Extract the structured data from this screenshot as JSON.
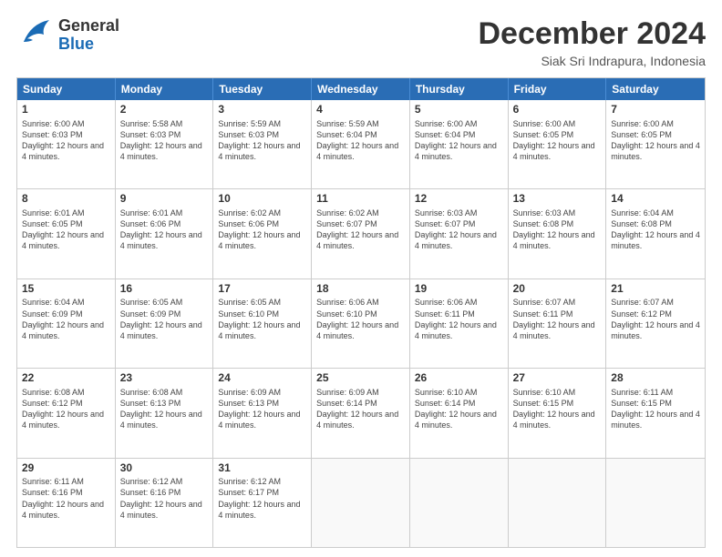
{
  "header": {
    "logo_general": "General",
    "logo_blue": "Blue",
    "month_title": "December 2024",
    "location": "Siak Sri Indrapura, Indonesia"
  },
  "days_of_week": [
    "Sunday",
    "Monday",
    "Tuesday",
    "Wednesday",
    "Thursday",
    "Friday",
    "Saturday"
  ],
  "weeks": [
    [
      {
        "day": 1,
        "sunrise": "6:00 AM",
        "sunset": "6:03 PM",
        "daylight": "12 hours and 4 minutes."
      },
      {
        "day": 2,
        "sunrise": "5:58 AM",
        "sunset": "6:03 PM",
        "daylight": "12 hours and 4 minutes."
      },
      {
        "day": 3,
        "sunrise": "5:59 AM",
        "sunset": "6:03 PM",
        "daylight": "12 hours and 4 minutes."
      },
      {
        "day": 4,
        "sunrise": "5:59 AM",
        "sunset": "6:04 PM",
        "daylight": "12 hours and 4 minutes."
      },
      {
        "day": 5,
        "sunrise": "6:00 AM",
        "sunset": "6:04 PM",
        "daylight": "12 hours and 4 minutes."
      },
      {
        "day": 6,
        "sunrise": "6:00 AM",
        "sunset": "6:05 PM",
        "daylight": "12 hours and 4 minutes."
      },
      {
        "day": 7,
        "sunrise": "6:00 AM",
        "sunset": "6:05 PM",
        "daylight": "12 hours and 4 minutes."
      }
    ],
    [
      {
        "day": 8,
        "sunrise": "6:01 AM",
        "sunset": "6:05 PM",
        "daylight": "12 hours and 4 minutes."
      },
      {
        "day": 9,
        "sunrise": "6:01 AM",
        "sunset": "6:06 PM",
        "daylight": "12 hours and 4 minutes."
      },
      {
        "day": 10,
        "sunrise": "6:02 AM",
        "sunset": "6:06 PM",
        "daylight": "12 hours and 4 minutes."
      },
      {
        "day": 11,
        "sunrise": "6:02 AM",
        "sunset": "6:07 PM",
        "daylight": "12 hours and 4 minutes."
      },
      {
        "day": 12,
        "sunrise": "6:03 AM",
        "sunset": "6:07 PM",
        "daylight": "12 hours and 4 minutes."
      },
      {
        "day": 13,
        "sunrise": "6:03 AM",
        "sunset": "6:08 PM",
        "daylight": "12 hours and 4 minutes."
      },
      {
        "day": 14,
        "sunrise": "6:04 AM",
        "sunset": "6:08 PM",
        "daylight": "12 hours and 4 minutes."
      }
    ],
    [
      {
        "day": 15,
        "sunrise": "6:04 AM",
        "sunset": "6:09 PM",
        "daylight": "12 hours and 4 minutes."
      },
      {
        "day": 16,
        "sunrise": "6:05 AM",
        "sunset": "6:09 PM",
        "daylight": "12 hours and 4 minutes."
      },
      {
        "day": 17,
        "sunrise": "6:05 AM",
        "sunset": "6:10 PM",
        "daylight": "12 hours and 4 minutes."
      },
      {
        "day": 18,
        "sunrise": "6:06 AM",
        "sunset": "6:10 PM",
        "daylight": "12 hours and 4 minutes."
      },
      {
        "day": 19,
        "sunrise": "6:06 AM",
        "sunset": "6:11 PM",
        "daylight": "12 hours and 4 minutes."
      },
      {
        "day": 20,
        "sunrise": "6:07 AM",
        "sunset": "6:11 PM",
        "daylight": "12 hours and 4 minutes."
      },
      {
        "day": 21,
        "sunrise": "6:07 AM",
        "sunset": "6:12 PM",
        "daylight": "12 hours and 4 minutes."
      }
    ],
    [
      {
        "day": 22,
        "sunrise": "6:08 AM",
        "sunset": "6:12 PM",
        "daylight": "12 hours and 4 minutes."
      },
      {
        "day": 23,
        "sunrise": "6:08 AM",
        "sunset": "6:13 PM",
        "daylight": "12 hours and 4 minutes."
      },
      {
        "day": 24,
        "sunrise": "6:09 AM",
        "sunset": "6:13 PM",
        "daylight": "12 hours and 4 minutes."
      },
      {
        "day": 25,
        "sunrise": "6:09 AM",
        "sunset": "6:14 PM",
        "daylight": "12 hours and 4 minutes."
      },
      {
        "day": 26,
        "sunrise": "6:10 AM",
        "sunset": "6:14 PM",
        "daylight": "12 hours and 4 minutes."
      },
      {
        "day": 27,
        "sunrise": "6:10 AM",
        "sunset": "6:15 PM",
        "daylight": "12 hours and 4 minutes."
      },
      {
        "day": 28,
        "sunrise": "6:11 AM",
        "sunset": "6:15 PM",
        "daylight": "12 hours and 4 minutes."
      }
    ],
    [
      {
        "day": 29,
        "sunrise": "6:11 AM",
        "sunset": "6:16 PM",
        "daylight": "12 hours and 4 minutes."
      },
      {
        "day": 30,
        "sunrise": "6:12 AM",
        "sunset": "6:16 PM",
        "daylight": "12 hours and 4 minutes."
      },
      {
        "day": 31,
        "sunrise": "6:12 AM",
        "sunset": "6:17 PM",
        "daylight": "12 hours and 4 minutes."
      },
      null,
      null,
      null,
      null
    ]
  ]
}
